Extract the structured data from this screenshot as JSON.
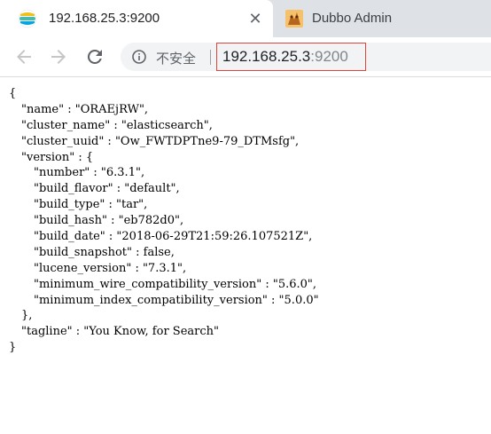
{
  "tabs": [
    {
      "title": "192.168.25.3:9200",
      "icon": "elasticsearch-icon",
      "active": true
    },
    {
      "title": "Dubbo Admin",
      "icon": "dubbo-logo-icon",
      "active": false
    }
  ],
  "toolbar": {
    "security_label": "不安全",
    "url_host": "192.168.25.3",
    "url_port": ":9200",
    "highlight_color": "#e0443d"
  },
  "json": {
    "open_brace": "{",
    "name": "\"name\" : \"ORAEjRW\",",
    "cluster_name": "\"cluster_name\" : \"elasticsearch\",",
    "cluster_uuid": "\"cluster_uuid\" : \"Ow_FWTDPTne9-79_DTMsfg\",",
    "version_open": "\"version\" : {",
    "number": "\"number\" : \"6.3.1\",",
    "build_flavor": "\"build_flavor\" : \"default\",",
    "build_type": "\"build_type\" : \"tar\",",
    "build_hash": "\"build_hash\" : \"eb782d0\",",
    "build_date": "\"build_date\" : \"2018-06-29T21:59:26.107521Z\",",
    "build_snapshot": "\"build_snapshot\" : false,",
    "lucene_version": "\"lucene_version\" : \"7.3.1\",",
    "min_wire": "\"minimum_wire_compatibility_version\" : \"5.6.0\",",
    "min_index": "\"minimum_index_compatibility_version\" : \"5.0.0\"",
    "version_close": "},",
    "tagline": "\"tagline\" : \"You Know, for Search\"",
    "close_brace": "}"
  }
}
